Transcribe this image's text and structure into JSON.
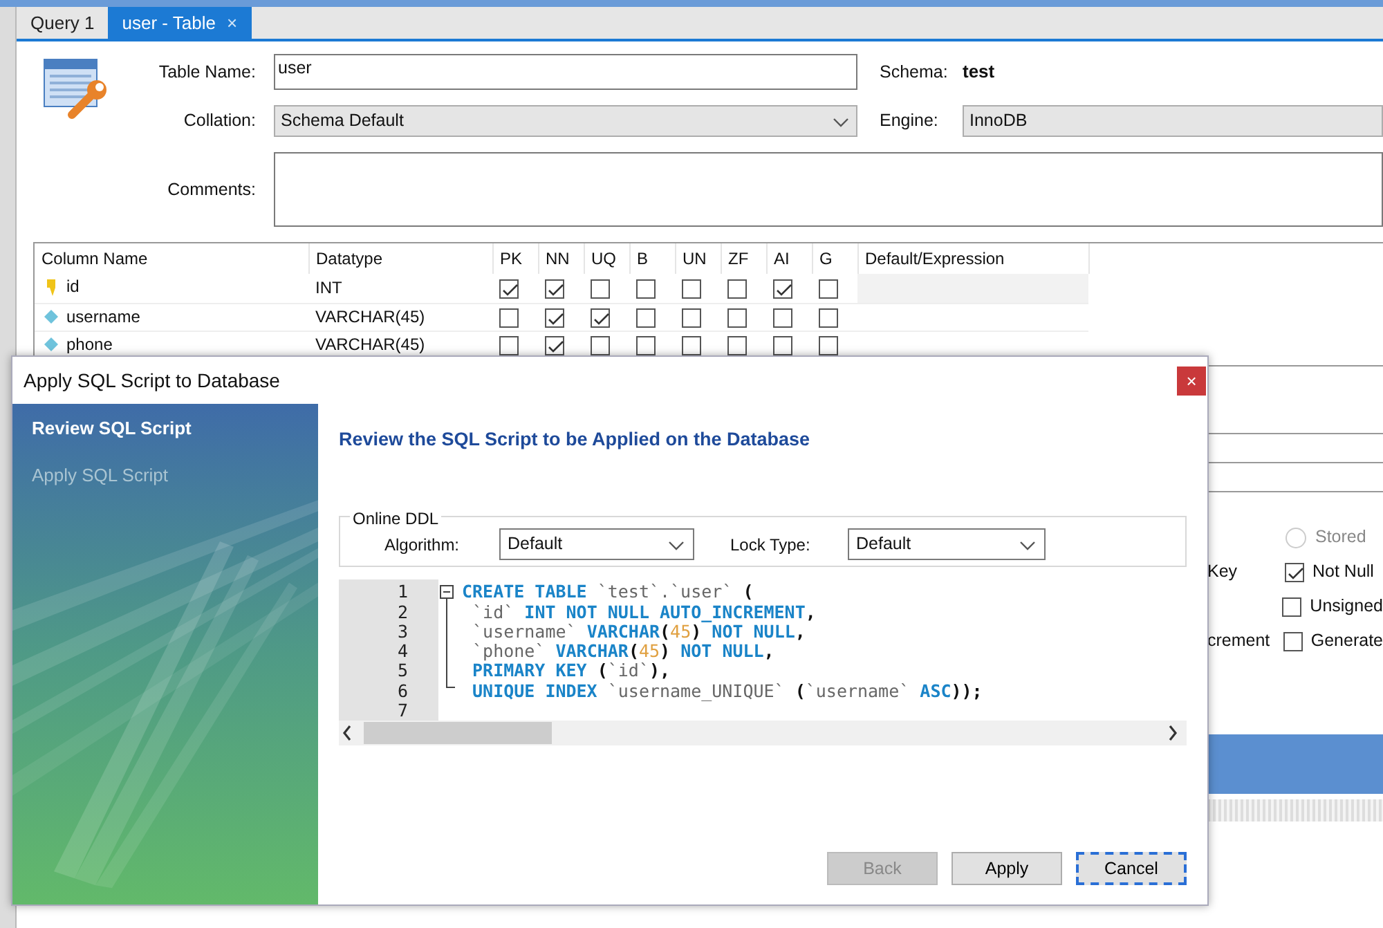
{
  "tabs": [
    {
      "label": "Query 1",
      "selected": false
    },
    {
      "label": "user - Table",
      "selected": true,
      "close": "×"
    }
  ],
  "form": {
    "table_name_label": "Table Name:",
    "table_name": "user",
    "collation_label": "Collation:",
    "collation": "Schema Default",
    "comments_label": "Comments:",
    "schema_label": "Schema:",
    "schema": "test",
    "engine_label": "Engine:",
    "engine": "InnoDB"
  },
  "columns_grid": {
    "headers": [
      "Column Name",
      "Datatype",
      "PK",
      "NN",
      "UQ",
      "B",
      "UN",
      "ZF",
      "AI",
      "G",
      "Default/Expression"
    ],
    "rows": [
      {
        "kind": "primary_key",
        "name": "id",
        "datatype": "INT",
        "flags": [
          true,
          true,
          false,
          false,
          false,
          false,
          true,
          false
        ]
      },
      {
        "kind": "column",
        "name": "username",
        "datatype": "VARCHAR(45)",
        "flags": [
          false,
          true,
          true,
          false,
          false,
          false,
          false,
          false
        ]
      },
      {
        "kind": "column",
        "name": "phone",
        "datatype": "VARCHAR(45)",
        "flags": [
          false,
          true,
          false,
          false,
          false,
          false,
          false,
          false
        ]
      }
    ]
  },
  "column_details": [
    {
      "option": {
        "kind": "radio",
        "label": "Stored",
        "checked": false,
        "disabled": true
      }
    },
    {
      "side_label": "Key",
      "option": {
        "kind": "checkbox",
        "label": "Not Null",
        "checked": true,
        "disabled": false
      }
    },
    {
      "option": {
        "kind": "checkbox",
        "label": "Unsigned",
        "checked": false,
        "disabled": false
      }
    },
    {
      "side_label": "crement",
      "option": {
        "kind": "checkbox",
        "label": "Generate",
        "checked": false,
        "disabled": false
      }
    }
  ],
  "dialog": {
    "title": "Apply SQL Script to Database",
    "close": "×",
    "steps": [
      {
        "label": "Review SQL Script",
        "selected": true
      },
      {
        "label": "Apply SQL Script",
        "selected": false
      }
    ],
    "heading": "Review the SQL Script to be Applied on the Database",
    "online_ddl": {
      "legend": "Online DDL",
      "algorithm_label": "Algorithm:",
      "algorithm": "Default",
      "lock_type_label": "Lock Type:",
      "lock_type": "Default"
    },
    "sql_lines": [
      {
        "number": "1",
        "segments": [
          {
            "kind": "keyword",
            "text": "CREATE TABLE"
          },
          {
            "kind": "identifier",
            "text": " `test`.`user` "
          },
          {
            "kind": "punct",
            "text": "("
          }
        ]
      },
      {
        "number": "2",
        "segments": [
          {
            "kind": "identifier",
            "text": " `id`"
          },
          {
            "kind": "keyword",
            "text": " INT NOT NULL AUTO_INCREMENT"
          },
          {
            "kind": "punct",
            "text": ","
          }
        ]
      },
      {
        "number": "3",
        "segments": [
          {
            "kind": "identifier",
            "text": " `username`"
          },
          {
            "kind": "keyword",
            "text": " VARCHAR"
          },
          {
            "kind": "punct",
            "text": "("
          },
          {
            "kind": "number",
            "text": "45"
          },
          {
            "kind": "punct",
            "text": ")"
          },
          {
            "kind": "keyword",
            "text": " NOT NULL"
          },
          {
            "kind": "punct",
            "text": ","
          }
        ]
      },
      {
        "number": "4",
        "segments": [
          {
            "kind": "identifier",
            "text": " `phone`"
          },
          {
            "kind": "keyword",
            "text": " VARCHAR"
          },
          {
            "kind": "punct",
            "text": "("
          },
          {
            "kind": "number",
            "text": "45"
          },
          {
            "kind": "punct",
            "text": ")"
          },
          {
            "kind": "keyword",
            "text": " NOT NULL"
          },
          {
            "kind": "punct",
            "text": ","
          }
        ]
      },
      {
        "number": "5",
        "segments": [
          {
            "kind": "keyword",
            "text": " PRIMARY KEY"
          },
          {
            "kind": "punct",
            "text": " ("
          },
          {
            "kind": "identifier",
            "text": "`id`"
          },
          {
            "kind": "punct",
            "text": "),"
          }
        ]
      },
      {
        "number": "6",
        "segments": [
          {
            "kind": "keyword",
            "text": " UNIQUE INDEX"
          },
          {
            "kind": "identifier",
            "text": " `username_UNIQUE` "
          },
          {
            "kind": "punct",
            "text": "("
          },
          {
            "kind": "identifier",
            "text": "`username`"
          },
          {
            "kind": "keyword",
            "text": " ASC"
          },
          {
            "kind": "punct",
            "text": "));"
          }
        ]
      },
      {
        "number": "7"
      }
    ],
    "buttons": [
      {
        "label": "Back",
        "disabled": true,
        "focused": false
      },
      {
        "label": "Apply",
        "disabled": false,
        "focused": false
      },
      {
        "label": "Cancel",
        "disabled": false,
        "focused": true
      }
    ]
  }
}
